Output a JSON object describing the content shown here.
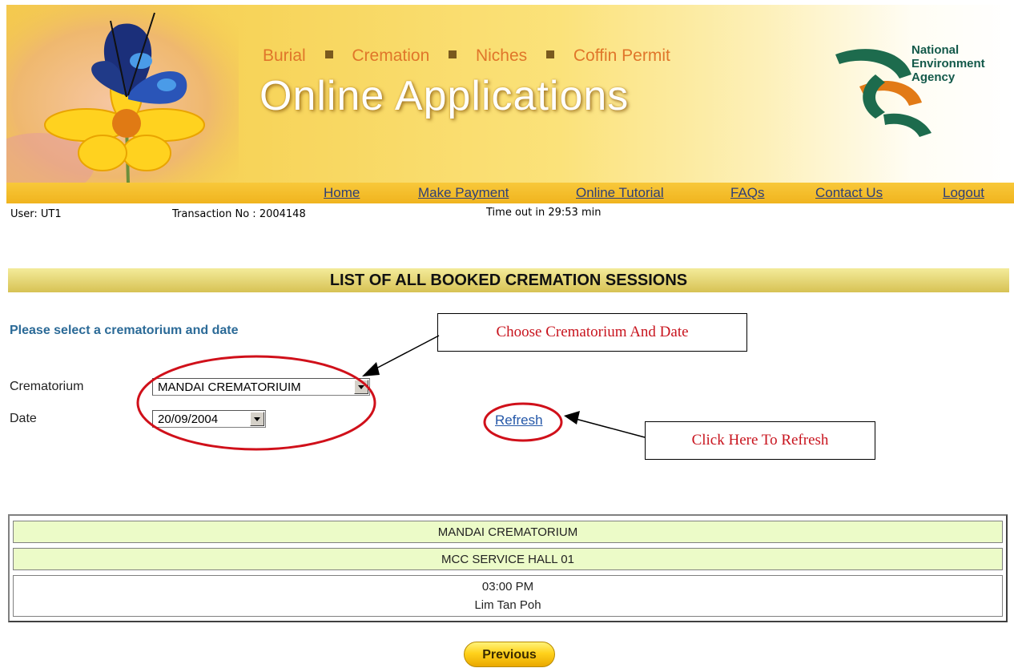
{
  "banner": {
    "services": [
      "Burial",
      "Cremation",
      "Niches",
      "Coffin Permit"
    ],
    "title": "Online Applications",
    "agency_line1": "National",
    "agency_line2": "Environment",
    "agency_line3": "Agency"
  },
  "nav": {
    "home": "Home",
    "make_payment": "Make Payment",
    "online_tutorial": "Online Tutorial",
    "faqs": "FAQs",
    "contact_us": "Contact Us",
    "logout": "Logout"
  },
  "status": {
    "user": "User: UT1",
    "transaction": "Transaction No : 2004148",
    "timeout": "Time out in 29:53 min"
  },
  "page": {
    "heading": "LIST OF ALL BOOKED CREMATION SESSIONS",
    "prompt": "Please select a crematorium and date",
    "crematorium_label": "Crematorium",
    "crematorium_value": "MANDAI CREMATORIUIM",
    "date_label": "Date",
    "date_value": "20/09/2004",
    "refresh": "Refresh"
  },
  "callouts": {
    "choose": "Choose Crematorium And Date",
    "refresh": "Click Here To Refresh"
  },
  "results": {
    "crematorium": "MANDAI CREMATORIUM",
    "hall": "MCC SERVICE HALL 01",
    "time": "03:00 PM",
    "name": "Lim Tan Poh"
  },
  "buttons": {
    "previous": "Previous"
  },
  "colors": {
    "nav_bar": "#f0b41e",
    "heading_bar": "#d7c254",
    "result_row": "#ecfbc8",
    "callout_text": "#c8141e",
    "annotation_ellipse": "#d0101a"
  }
}
